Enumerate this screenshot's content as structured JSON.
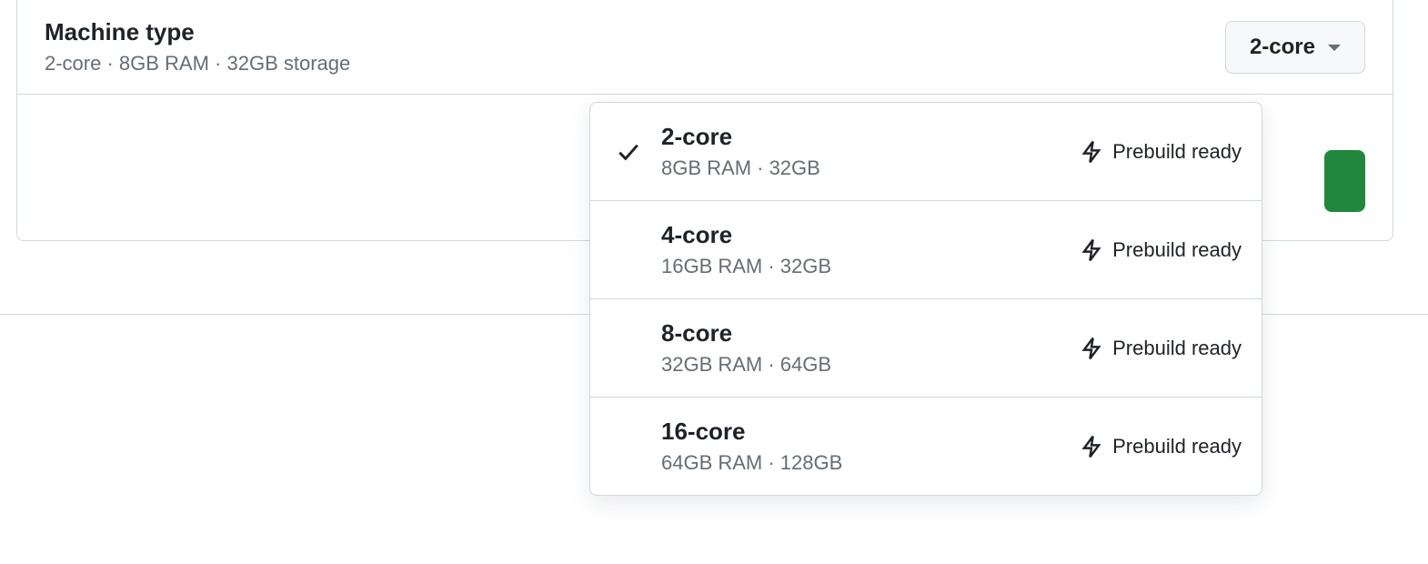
{
  "row": {
    "title": "Machine type",
    "subtitle": "2-core · 8GB RAM · 32GB storage",
    "selected": "2-core"
  },
  "dropdown": {
    "options": [
      {
        "title": "2-core",
        "sub": "8GB RAM · 32GB",
        "selected": true,
        "badge": "Prebuild ready"
      },
      {
        "title": "4-core",
        "sub": "16GB RAM · 32GB",
        "selected": false,
        "badge": "Prebuild ready"
      },
      {
        "title": "8-core",
        "sub": "32GB RAM · 64GB",
        "selected": false,
        "badge": "Prebuild ready"
      },
      {
        "title": "16-core",
        "sub": "64GB RAM · 128GB",
        "selected": false,
        "badge": "Prebuild ready"
      }
    ]
  }
}
